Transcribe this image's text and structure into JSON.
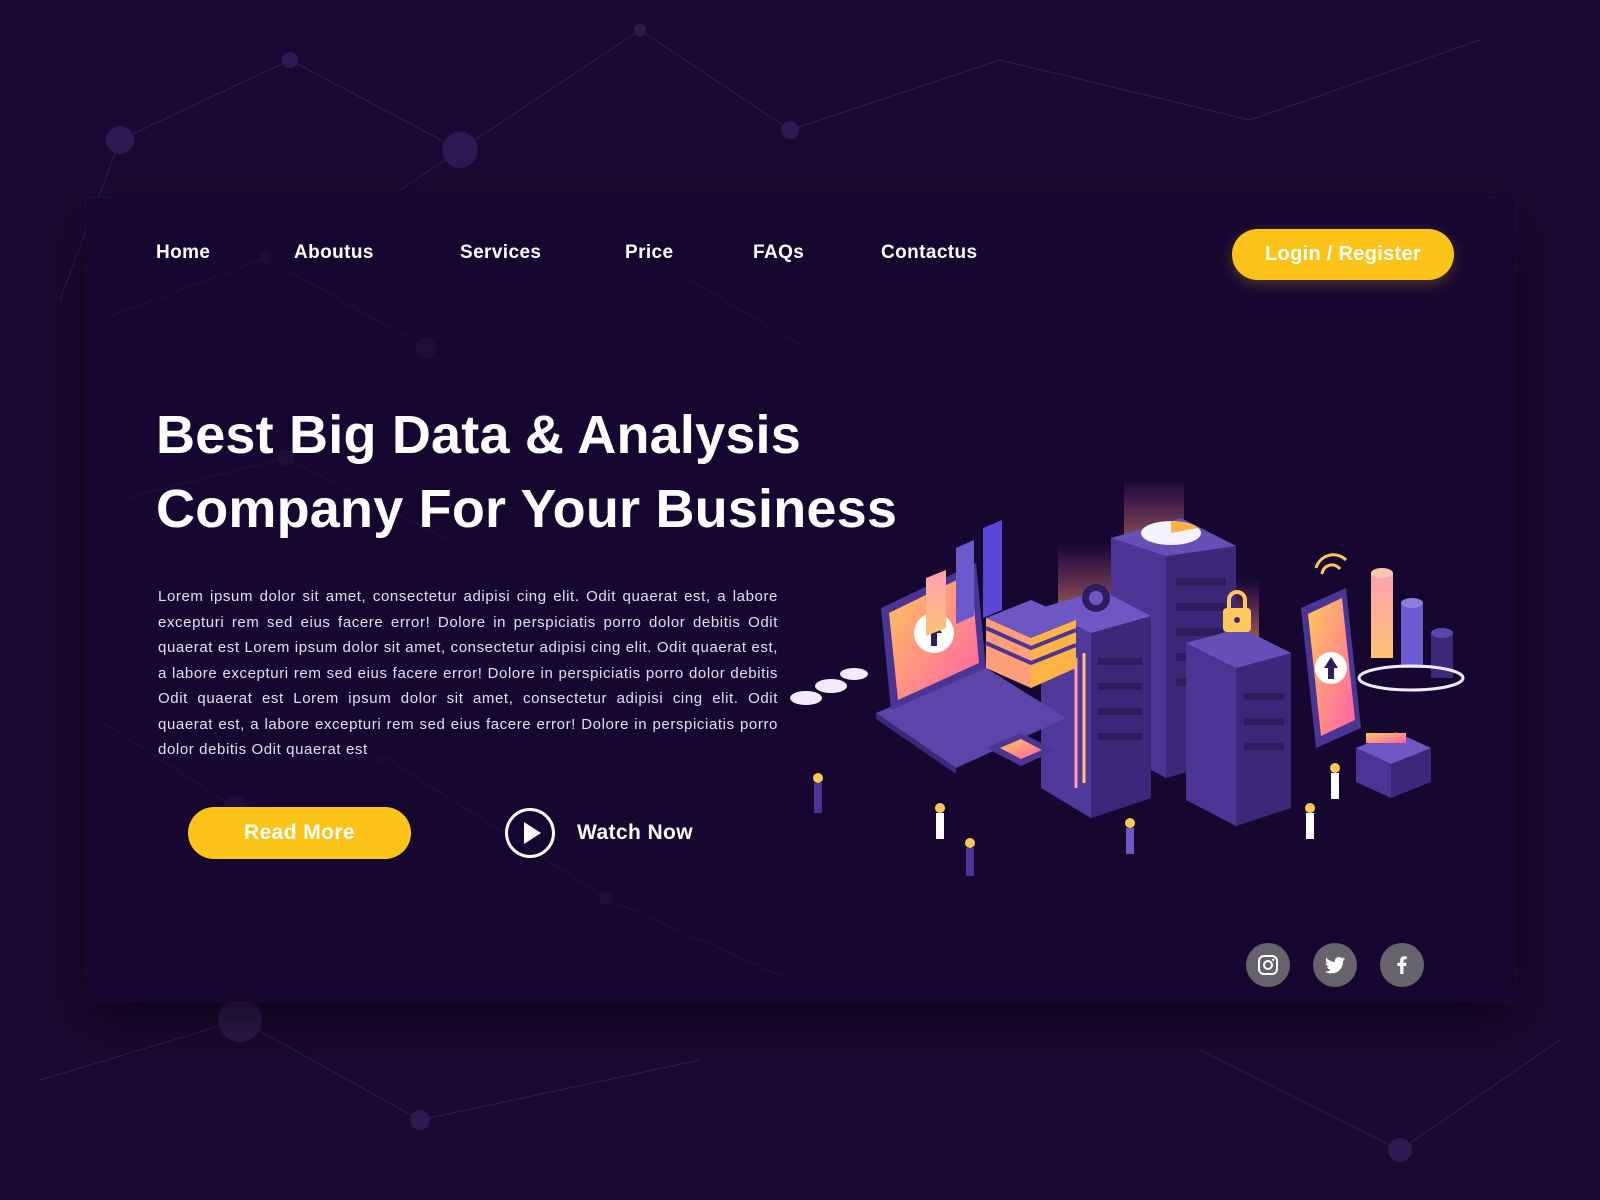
{
  "nav": {
    "items": [
      {
        "label": "Home"
      },
      {
        "label": "Aboutus"
      },
      {
        "label": "Services"
      },
      {
        "label": "Price"
      },
      {
        "label": "FAQs"
      },
      {
        "label": "Contactus"
      }
    ],
    "login_label": "Login / Register"
  },
  "hero": {
    "title_line1": "Best Big Data & Analysis",
    "title_line2": "Company For Your Business",
    "body": "Lorem ipsum dolor sit amet, consectetur adipisi cing elit. Odit quaerat est, a labore excepturi rem sed eius facere error! Dolore in perspiciatis porro dolor debitis Odit quaerat est Lorem ipsum dolor sit amet, consectetur adipisi cing elit. Odit quaerat est, a labore excepturi rem sed eius facere error! Dolore in perspiciatis porro dolor debitis Odit quaerat est Lorem ipsum dolor sit amet, consectetur adipisi cing elit. Odit quaerat est, a labore excepturi rem sed eius facere error! Dolore in perspiciatis porro dolor debitis Odit quaerat est",
    "read_more_label": "Read More",
    "watch_now_label": "Watch Now"
  },
  "social": {
    "icons": [
      "instagram-icon",
      "twitter-icon",
      "facebook-icon"
    ]
  },
  "colors": {
    "page_bg": "#1a0a33",
    "card_bg": "#160731",
    "accent": "#fcc419",
    "text": "#ffffff",
    "social_bg": "#66636b"
  }
}
